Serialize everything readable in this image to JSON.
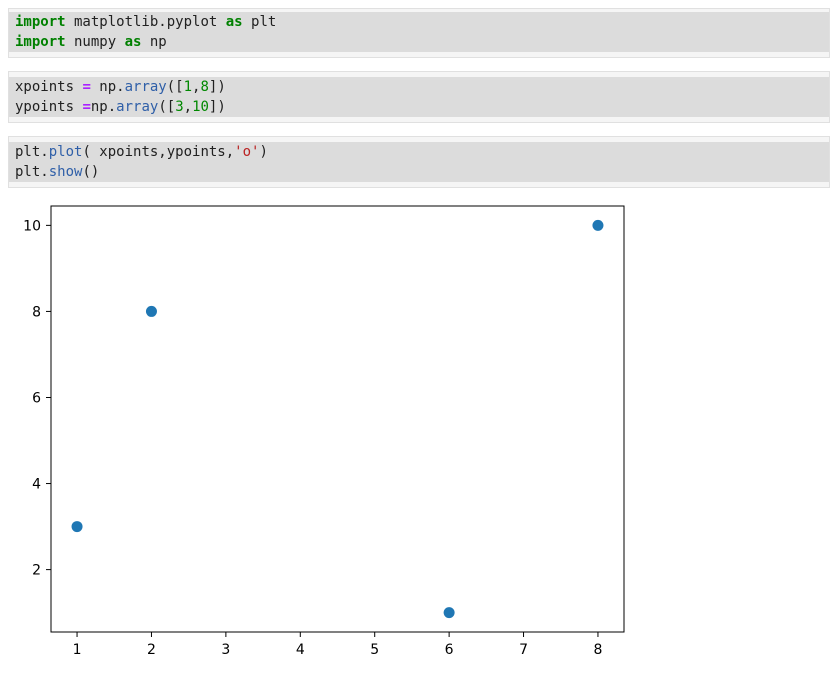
{
  "cells": [
    {
      "lines": [
        [
          {
            "t": "import",
            "c": "kw"
          },
          {
            "t": " matplotlib.pyplot ",
            "c": ""
          },
          {
            "t": "as",
            "c": "kw"
          },
          {
            "t": " plt",
            "c": ""
          }
        ],
        [
          {
            "t": "import",
            "c": "kw"
          },
          {
            "t": " numpy ",
            "c": ""
          },
          {
            "t": "as",
            "c": "kw"
          },
          {
            "t": " np",
            "c": ""
          }
        ]
      ]
    },
    {
      "lines": [
        [
          {
            "t": "xpoints ",
            "c": ""
          },
          {
            "t": "=",
            "c": "op"
          },
          {
            "t": " np.",
            "c": ""
          },
          {
            "t": "array",
            "c": "fn"
          },
          {
            "t": "([",
            "c": ""
          },
          {
            "t": "1",
            "c": "num"
          },
          {
            "t": ",",
            "c": ""
          },
          {
            "t": "8",
            "c": "num"
          },
          {
            "t": "])",
            "c": ""
          }
        ],
        [
          {
            "t": "ypoints ",
            "c": ""
          },
          {
            "t": "=",
            "c": "op"
          },
          {
            "t": "np.",
            "c": ""
          },
          {
            "t": "array",
            "c": "fn"
          },
          {
            "t": "([",
            "c": ""
          },
          {
            "t": "3",
            "c": "num"
          },
          {
            "t": ",",
            "c": ""
          },
          {
            "t": "10",
            "c": "num"
          },
          {
            "t": "])",
            "c": ""
          }
        ]
      ]
    },
    {
      "lines": [
        [
          {
            "t": "plt.",
            "c": ""
          },
          {
            "t": "plot",
            "c": "fn"
          },
          {
            "t": "( xpoints,ypoints,",
            "c": ""
          },
          {
            "t": "'o'",
            "c": "str"
          },
          {
            "t": ")",
            "c": ""
          }
        ],
        [
          {
            "t": "plt.",
            "c": ""
          },
          {
            "t": "show",
            "c": "fn"
          },
          {
            "t": "()",
            "c": ""
          }
        ]
      ]
    }
  ],
  "chart_data": {
    "type": "scatter",
    "x": [
      1,
      2,
      6,
      8
    ],
    "y": [
      3,
      8,
      1,
      10
    ],
    "xticks": [
      1,
      2,
      3,
      4,
      5,
      6,
      7,
      8
    ],
    "yticks": [
      2,
      4,
      6,
      8,
      10
    ],
    "xlim": [
      0.65,
      8.35
    ],
    "ylim": [
      0.55,
      10.45
    ],
    "marker_color": "#1f77b4",
    "title": "",
    "xlabel": "",
    "ylabel": "",
    "grid": false
  }
}
